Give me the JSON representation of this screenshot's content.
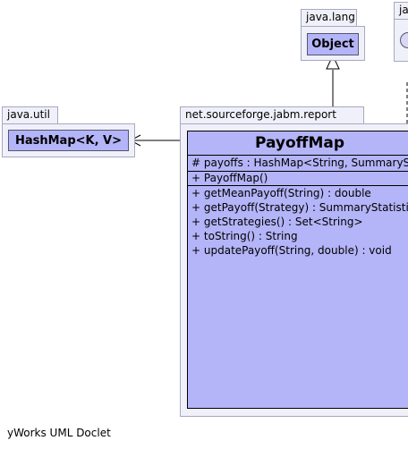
{
  "packages": {
    "java_lang": {
      "label": "java.lang",
      "class_name": "Object"
    },
    "java_util": {
      "label": "java.util",
      "class_name": "HashMap<K, V>"
    },
    "report": {
      "label": "net.sourceforge.jabm.report"
    },
    "partial": {
      "label": "ja"
    }
  },
  "main_class": {
    "name": "PayoffMap",
    "attributes": [
      {
        "visibility": "#",
        "text": "payoffs : HashMap<String, SummaryStatistics>"
      }
    ],
    "constructors": [
      {
        "visibility": "+",
        "text": "PayoffMap()"
      }
    ],
    "methods": [
      {
        "visibility": "+",
        "text": "getMeanPayoff(String) : double"
      },
      {
        "visibility": "+",
        "text": "getPayoff(Strategy) : SummaryStatistics"
      },
      {
        "visibility": "+",
        "text": "getStrategies() : Set<String>"
      },
      {
        "visibility": "+",
        "text": "toString() : String"
      },
      {
        "visibility": "+",
        "text": "updatePayoff(String, double) : void"
      }
    ]
  },
  "footer": "yWorks UML Doclet",
  "colors": {
    "package_fill": "#f0f0fa",
    "class_fill": "#b4b4f8",
    "line": "#000000"
  }
}
